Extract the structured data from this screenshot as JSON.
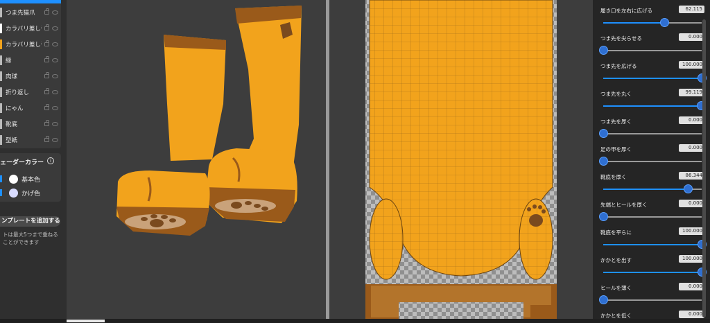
{
  "layers": [
    {
      "name": "つま先猫爪",
      "swatch": "#bbbbbb"
    },
    {
      "name": "カラバリ差し替えコピ",
      "swatch": "#ffffff"
    },
    {
      "name": "カラバリ差し替え",
      "swatch": "#f2a31c"
    },
    {
      "name": "縁",
      "swatch": "#bbbbbb"
    },
    {
      "name": "肉球",
      "swatch": "#bbbbbb"
    },
    {
      "name": "折り返し",
      "swatch": "#bbbbbb"
    },
    {
      "name": "にゃん",
      "swatch": "#bbbbbb"
    },
    {
      "name": "靴底",
      "swatch": "#bbbbbb"
    },
    {
      "name": "型紙",
      "swatch": "#bbbbbb"
    }
  ],
  "shader": {
    "title": "ェーダーカラー",
    "info_icon": "i",
    "colors": [
      {
        "label": "基本色",
        "color": "#ffffff"
      },
      {
        "label": "かげ色",
        "color": "#d9dcff"
      }
    ]
  },
  "template": {
    "add_button": "ンプレートを追加する",
    "note": "トは最大5つまで重ねることができます"
  },
  "params": [
    {
      "label": "履き口を左右に広げる",
      "value": "62.115",
      "level": 0.62
    },
    {
      "label": "つま先を尖らせる",
      "value": "0.000",
      "level": 0.0
    },
    {
      "label": "つま先を広げる",
      "value": "100.000",
      "level": 1.0
    },
    {
      "label": "つま先を丸く",
      "value": "99.119",
      "level": 0.99
    },
    {
      "label": "つま先を厚く",
      "value": "0.000",
      "level": 0.0
    },
    {
      "label": "足の甲を厚く",
      "value": "0.000",
      "level": 0.0
    },
    {
      "label": "靴底を厚く",
      "value": "86.344",
      "level": 0.86
    },
    {
      "label": "先端とヒールを厚く",
      "value": "0.000",
      "level": 0.0
    },
    {
      "label": "靴底を平らに",
      "value": "100.000",
      "level": 1.0
    },
    {
      "label": "かかとを出す",
      "value": "100.000",
      "level": 1.0
    },
    {
      "label": "ヒールを薄く",
      "value": "0.000",
      "level": 0.0
    },
    {
      "label": "かかとを低く",
      "value": "0.000",
      "level": 0.0
    }
  ],
  "colors": {
    "boot": "#f2a31c",
    "boot_dark": "#9a5a1a",
    "sole": "#8a5a2a",
    "accent": "#1e90ff"
  }
}
